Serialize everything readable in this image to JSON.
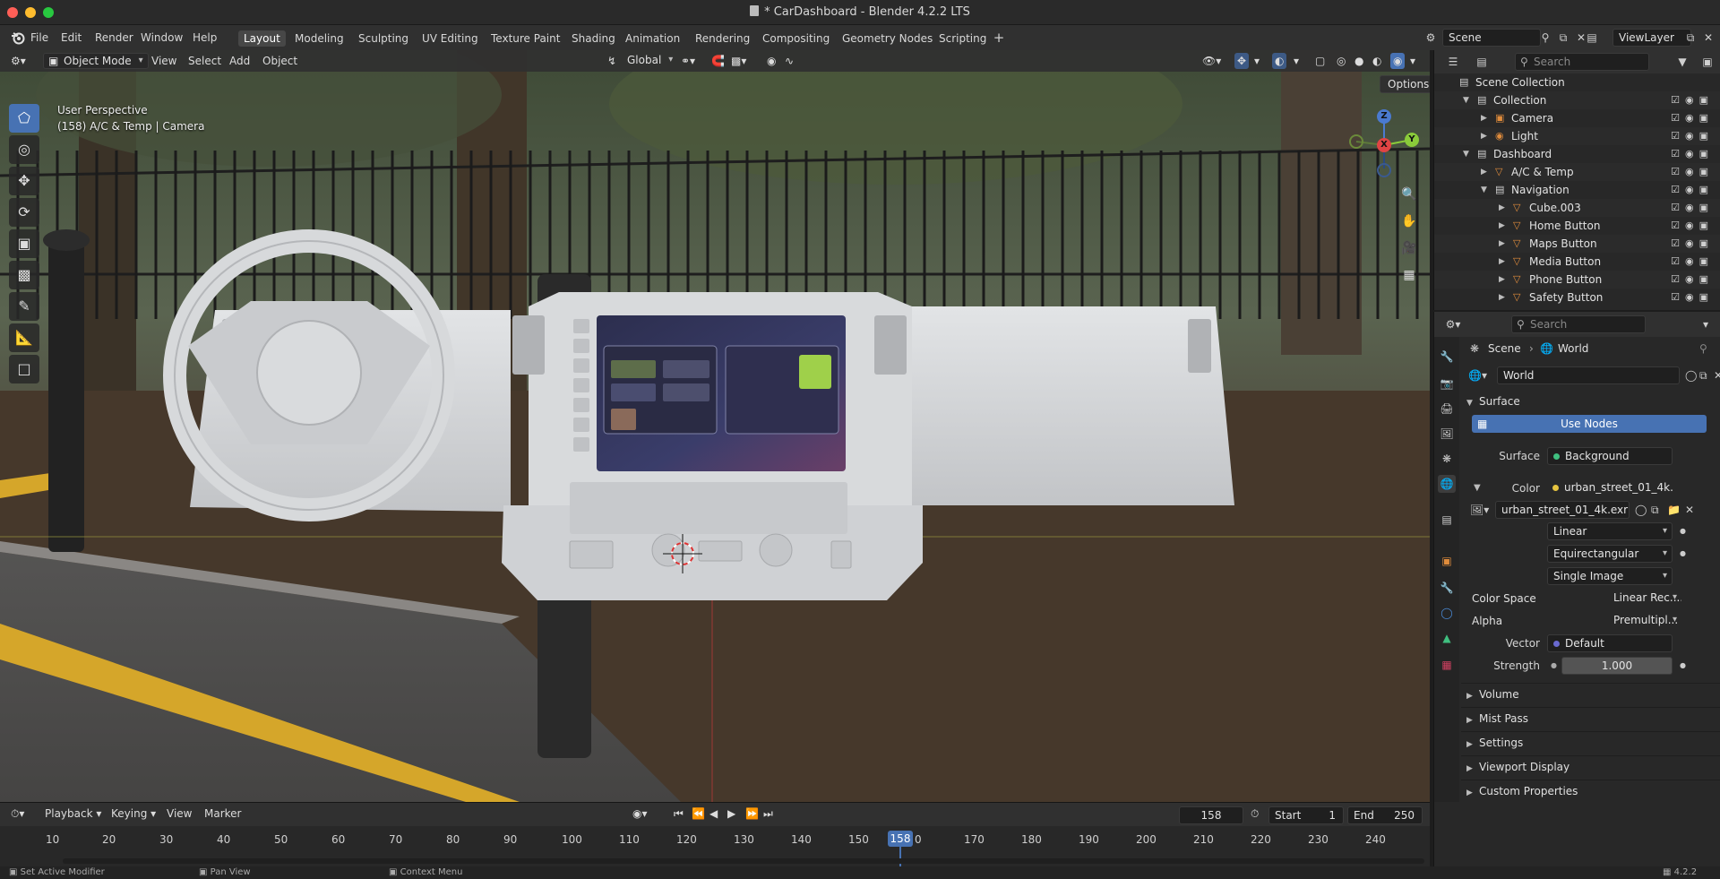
{
  "window": {
    "title": "* CarDashboard - Blender 4.2.2 LTS"
  },
  "menus": [
    "File",
    "Edit",
    "Render",
    "Window",
    "Help"
  ],
  "workspaces": [
    "Layout",
    "Modeling",
    "Sculpting",
    "UV Editing",
    "Texture Paint",
    "Shading",
    "Animation",
    "Rendering",
    "Compositing",
    "Geometry Nodes",
    "Scripting"
  ],
  "active_workspace": "Layout",
  "scene": {
    "scene_name": "Scene",
    "view_layer": "ViewLayer"
  },
  "viewport_header": {
    "mode": "Object Mode",
    "menus": [
      "View",
      "Select",
      "Add",
      "Object"
    ],
    "transform_orientation": "Global",
    "options_label": "Options"
  },
  "viewport": {
    "perspective_label": "User Perspective",
    "object_label": "(158) A/C & Temp | Camera",
    "gizmo": {
      "z": "Z",
      "x": "X",
      "y": "Y"
    }
  },
  "outliner": {
    "search_placeholder": "Search",
    "rows": [
      {
        "label": "Scene Collection",
        "depth": 0,
        "icon": "scene-collection-icon",
        "arrow": "",
        "color": "#d0d0d0"
      },
      {
        "label": "Collection",
        "depth": 1,
        "icon": "collection-icon",
        "arrow": "▼",
        "color": "#d0d0d0"
      },
      {
        "label": "Camera",
        "depth": 2,
        "icon": "camera-icon",
        "arrow": "▶",
        "color": "#e08c3c"
      },
      {
        "label": "Light",
        "depth": 2,
        "icon": "light-icon",
        "arrow": "▶",
        "color": "#e08c3c"
      },
      {
        "label": "Dashboard",
        "depth": 1,
        "icon": "collection-icon",
        "arrow": "▼",
        "color": "#d0d0d0"
      },
      {
        "label": "A/C & Temp",
        "depth": 2,
        "icon": "mesh-icon",
        "arrow": "▶",
        "color": "#e08c3c"
      },
      {
        "label": "Navigation",
        "depth": 2,
        "icon": "collection-icon",
        "arrow": "▼",
        "color": "#d0d0d0"
      },
      {
        "label": "Cube.003",
        "depth": 3,
        "icon": "mesh-icon",
        "arrow": "▶",
        "color": "#e08c3c"
      },
      {
        "label": "Home Button",
        "depth": 3,
        "icon": "mesh-icon",
        "arrow": "▶",
        "color": "#e08c3c"
      },
      {
        "label": "Maps Button",
        "depth": 3,
        "icon": "mesh-icon",
        "arrow": "▶",
        "color": "#e08c3c"
      },
      {
        "label": "Media Button",
        "depth": 3,
        "icon": "mesh-icon",
        "arrow": "▶",
        "color": "#e08c3c"
      },
      {
        "label": "Phone Button",
        "depth": 3,
        "icon": "mesh-icon",
        "arrow": "▶",
        "color": "#e08c3c"
      },
      {
        "label": "Safety Button",
        "depth": 3,
        "icon": "mesh-icon",
        "arrow": "▶",
        "color": "#e08c3c"
      }
    ]
  },
  "properties": {
    "search_placeholder": "Search",
    "breadcrumb": {
      "scene": "Scene",
      "world": "World"
    },
    "world_name": "World",
    "surface_section": "Surface",
    "use_nodes": "Use Nodes",
    "surface_label": "Surface",
    "surface_value": "Background",
    "color_label": "Color",
    "color_value": "urban_street_01_4k....",
    "image_name": "urban_street_01_4k.exr",
    "interpolation": "Linear",
    "projection": "Equirectangular",
    "source": "Single Image",
    "color_space_label": "Color Space",
    "color_space_value": "Linear Rec....",
    "alpha_label": "Alpha",
    "alpha_value": "Premultipl...",
    "vector_label": "Vector",
    "vector_value": "Default",
    "strength_label": "Strength",
    "strength_value": "1.000",
    "sections": [
      "Volume",
      "Mist Pass",
      "Settings",
      "Viewport Display",
      "Custom Properties"
    ]
  },
  "timeline": {
    "menus": [
      "Playback",
      "Keying",
      "View",
      "Marker"
    ],
    "current_frame": "158",
    "start_label": "Start",
    "start_value": "1",
    "end_label": "End",
    "end_value": "250",
    "ruler": [
      "10",
      "20",
      "30",
      "40",
      "50",
      "60",
      "70",
      "80",
      "90",
      "100",
      "110",
      "120",
      "130",
      "140",
      "150",
      "170",
      "180",
      "190",
      "200",
      "210",
      "220",
      "230",
      "240"
    ],
    "playhead_label": "158",
    "playhead_suffix": "0"
  },
  "statusbar": {
    "left": "Set Active Modifier",
    "middle": "Pan View",
    "right": "Context Menu",
    "version": "4.2.2"
  },
  "colors": {
    "accent": "#4772b3",
    "object_orange": "#e08c3c",
    "mesh_green": "#3fbf7f"
  }
}
